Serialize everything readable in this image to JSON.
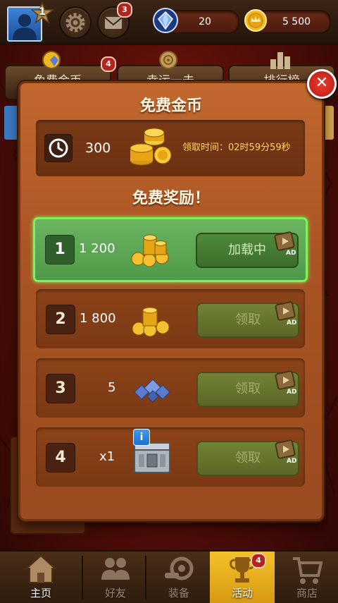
{
  "top_bar": {
    "level": "1",
    "settings_icon": "gear-icon",
    "mail_icon": "envelope-icon",
    "mail_badge": "3",
    "gems": "20",
    "coins": "5 500"
  },
  "tabs": {
    "free_coins_label": "免费金币",
    "free_coins_badge": "4",
    "lucky_label": "幸运一击",
    "ranking_label": "排行榜"
  },
  "dialog": {
    "title": "免费金币",
    "timer": {
      "amount": "300",
      "label": "领取时间：02时59分59秒"
    },
    "subtitle": "免费奖励！",
    "rewards": [
      {
        "index": "1",
        "amount": "1 200",
        "icon": "coin-pile-icon",
        "button": "加载中",
        "state": "active"
      },
      {
        "index": "2",
        "amount": "1 800",
        "icon": "coin-pile-icon",
        "button": "领取",
        "state": "disabled"
      },
      {
        "index": "3",
        "amount": "5",
        "icon": "gem-pile-icon",
        "button": "领取",
        "state": "disabled"
      },
      {
        "index": "4",
        "amount": "x1",
        "icon": "chest-icon",
        "button": "领取",
        "state": "disabled"
      }
    ]
  },
  "bottom_nav": [
    {
      "label": "主页",
      "icon": "house-icon"
    },
    {
      "label": "好友",
      "icon": "friends-icon"
    },
    {
      "label": "装备",
      "icon": "equipment-icon"
    },
    {
      "label": "活动",
      "icon": "trophy-icon",
      "badge": "4"
    },
    {
      "label": "商店",
      "icon": "cart-icon"
    }
  ],
  "colors": {
    "dialog": "#b15b27",
    "active_row": "#5ea753",
    "active_border": "#7df25a",
    "claim_button": "#5f7d32",
    "nav_active": "#eab31f",
    "badge": "#b3241d"
  }
}
